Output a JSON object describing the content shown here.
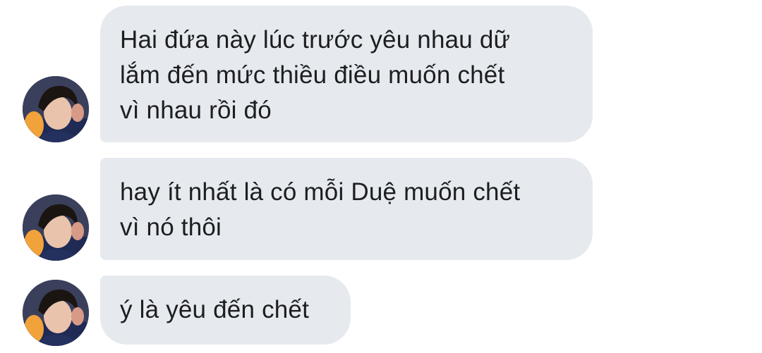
{
  "messages": [
    {
      "text": "Hai đứa này lúc trước yêu nhau dữ\nlắm đến mức thiều điều muốn chết\nvì nhau rồi đó",
      "avatar": "user-avatar"
    },
    {
      "text": "hay ít nhất là có mỗi Duệ muốn chết\nvì nó thôi",
      "avatar": "user-avatar"
    },
    {
      "text": "ý là yêu đến chết",
      "avatar": "user-avatar"
    }
  ],
  "colors": {
    "bubble": "#e6e9ee",
    "text": "#1c1e21",
    "background": "#ffffff"
  }
}
